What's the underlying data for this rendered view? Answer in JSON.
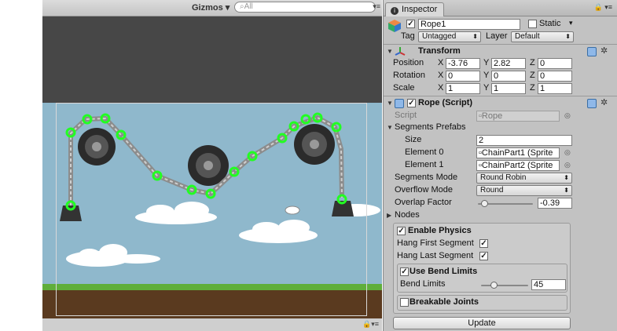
{
  "scene": {
    "gizmos_label": "Gizmos",
    "search_placeholder": "All"
  },
  "inspector": {
    "tab_label": "Inspector",
    "object_name": "Rope1",
    "active": true,
    "static_label": "Static",
    "static_checked": false,
    "tag_label": "Tag",
    "tag_value": "Untagged",
    "layer_label": "Layer",
    "layer_value": "Default",
    "transform": {
      "title": "Transform",
      "position_label": "Position",
      "rotation_label": "Rotation",
      "scale_label": "Scale",
      "x_label": "X",
      "y_label": "Y",
      "z_label": "Z",
      "position": {
        "x": "-3.76",
        "y": "2.82",
        "z": "0"
      },
      "rotation": {
        "x": "0",
        "y": "0",
        "z": "0"
      },
      "scale": {
        "x": "1",
        "y": "1",
        "z": "1"
      }
    },
    "rope": {
      "title": "Rope (Script)",
      "script_label": "Script",
      "script_value": "Rope",
      "segments_prefabs_label": "Segments Prefabs",
      "size_label": "Size",
      "size_value": "2",
      "element0_label": "Element 0",
      "element0_value": "ChainPart1 (Sprite",
      "element1_label": "Element 1",
      "element1_value": "ChainPart2 (Sprite",
      "segments_mode_label": "Segments Mode",
      "segments_mode_value": "Round Robin",
      "overflow_mode_label": "Overflow Mode",
      "overflow_mode_value": "Round",
      "overlap_factor_label": "Overlap Factor",
      "overlap_factor_value": "-0.39",
      "nodes_label": "Nodes",
      "enable_physics_label": "Enable Physics",
      "hang_first_label": "Hang First Segment",
      "hang_last_label": "Hang Last Segment",
      "use_bend_limits_label": "Use Bend Limits",
      "bend_limits_label": "Bend Limits",
      "bend_limits_value": "45",
      "breakable_joints_label": "Breakable Joints",
      "update_label": "Update"
    }
  }
}
